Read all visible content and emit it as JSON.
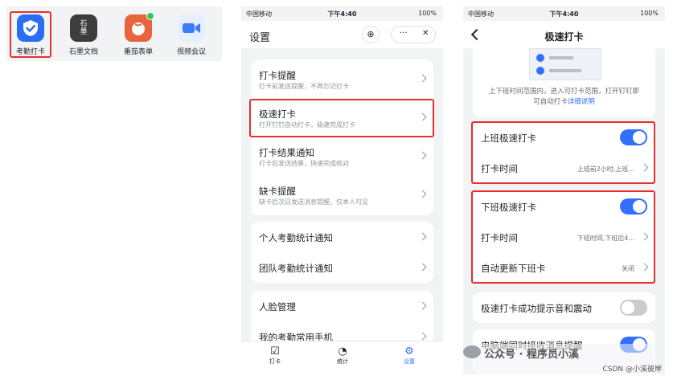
{
  "apps": [
    {
      "label": "考勤打卡",
      "icon": "checkmark-shield-icon",
      "color": "#2a6ef5"
    },
    {
      "label": "石墨文档",
      "icon": "shimo-docs-icon",
      "glyph": "石\n墨",
      "color": "#3d3d3d"
    },
    {
      "label": "番茄表单",
      "icon": "tomato-form-icon",
      "color": "#e8643c"
    },
    {
      "label": "视频会议",
      "icon": "video-camera-icon",
      "color": "#3a7bf6"
    }
  ],
  "status": {
    "carrier": "中国移动",
    "time": "下午4:40",
    "battery": "100%"
  },
  "settings": {
    "title": "设置",
    "group1": [
      {
        "title": "打卡提醒",
        "sub": "打卡前发送提醒，不再忘记打卡"
      },
      {
        "title": "极速打卡",
        "sub": "打开钉钉自动打卡，极速完成打卡"
      },
      {
        "title": "打卡结果通知",
        "sub": "打卡后发送结果，快速完成核对"
      },
      {
        "title": "缺卡提醒",
        "sub": "缺卡后次日发送消息提醒，仅本人可见"
      }
    ],
    "group2": [
      "个人考勤统计通知",
      "团队考勤统计通知"
    ],
    "group3": [
      "人脸管理",
      "我的考勤常用手机"
    ],
    "tabs": [
      "打卡",
      "统计",
      "设置"
    ]
  },
  "speed": {
    "title": "极速打卡",
    "desc_line1": "上下班时间范围内，进入可打卡范围，打开钉钉即",
    "desc_line2": "可自动打卡",
    "desc_link": "详细说明",
    "on_duty": {
      "label": "上班极速打卡",
      "time_label": "打卡时间",
      "time_value": "上班前2小时,上班..."
    },
    "off_duty": {
      "label": "下班极速打卡",
      "time_label": "打卡时间",
      "time_value": "下班时间,下班后4...",
      "auto_label": "自动更新下班卡",
      "auto_value": "关闭"
    },
    "sound_label": "极速打卡成功提示音和震动",
    "pc_label": "电脑端同时接收消息提醒"
  },
  "watermark": {
    "main": "公众号 · 程序员小溪",
    "sub": "CSDN @小溪彼岸"
  },
  "colors": {
    "accent": "#3370ff",
    "highlight": "#e5302f"
  }
}
